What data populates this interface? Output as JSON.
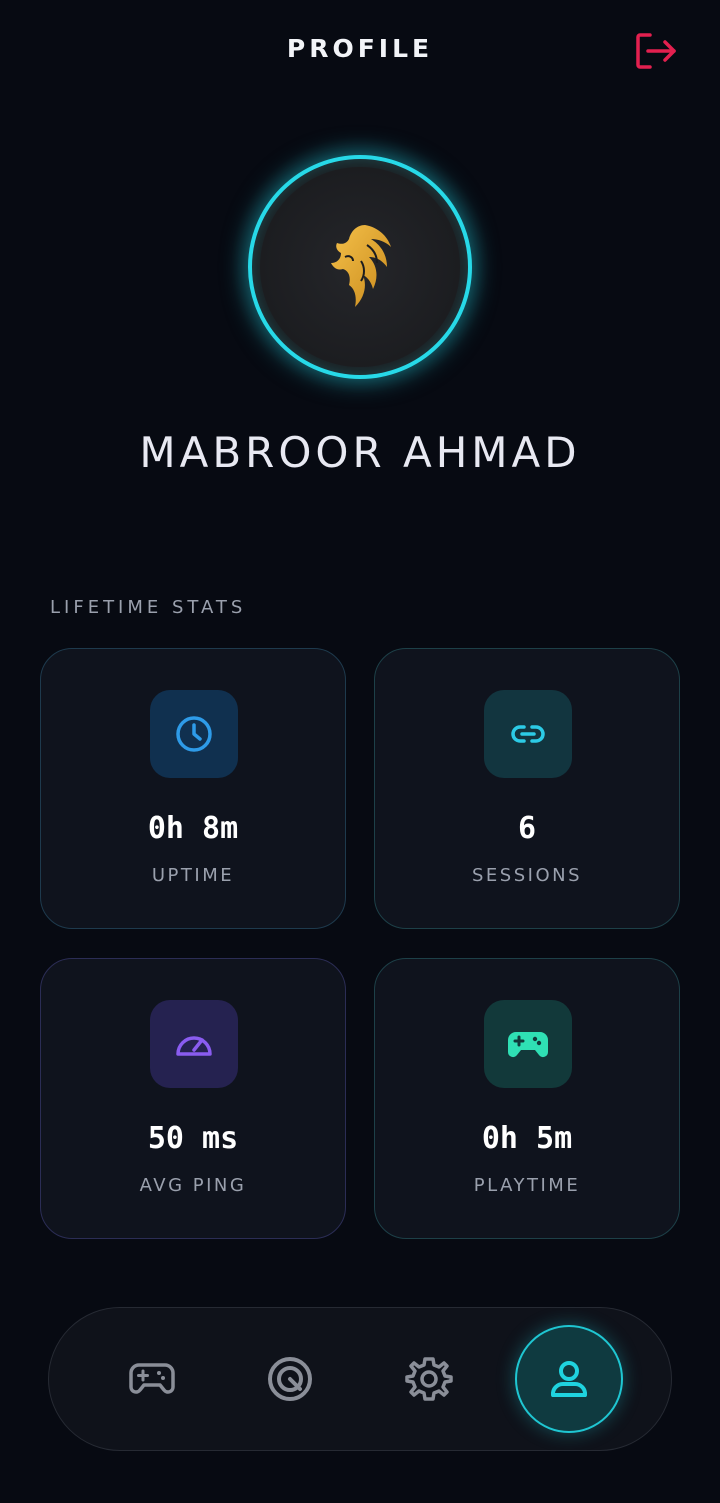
{
  "header": {
    "title": "PROFILE",
    "logout_icon": "logout-icon",
    "logout_color": "#e3204f"
  },
  "profile": {
    "name": "MABROOR AHMAD",
    "avatar_icon": "lion-logo",
    "ring_color": "#27d9e8"
  },
  "stats": {
    "section_label": "LIFETIME STATS",
    "cards": [
      {
        "icon": "clock-icon",
        "value": "0h 8m",
        "label": "UPTIME",
        "accent": "#2e9be8"
      },
      {
        "icon": "link-icon",
        "value": "6",
        "label": "SESSIONS",
        "accent": "#2ccbe6"
      },
      {
        "icon": "speedometer-icon",
        "value": "50 ms",
        "label": "AVG PING",
        "accent": "#8a5cf0"
      },
      {
        "icon": "gamepad-icon",
        "value": "0h 5m",
        "label": "PLAYTIME",
        "accent": "#2fe0b4"
      }
    ]
  },
  "nav": {
    "items": [
      {
        "icon": "gamepad-icon",
        "active": false
      },
      {
        "icon": "target-icon",
        "active": false
      },
      {
        "icon": "gear-icon",
        "active": false
      },
      {
        "icon": "user-icon",
        "active": true
      }
    ],
    "active_color": "#1fc6d2"
  }
}
